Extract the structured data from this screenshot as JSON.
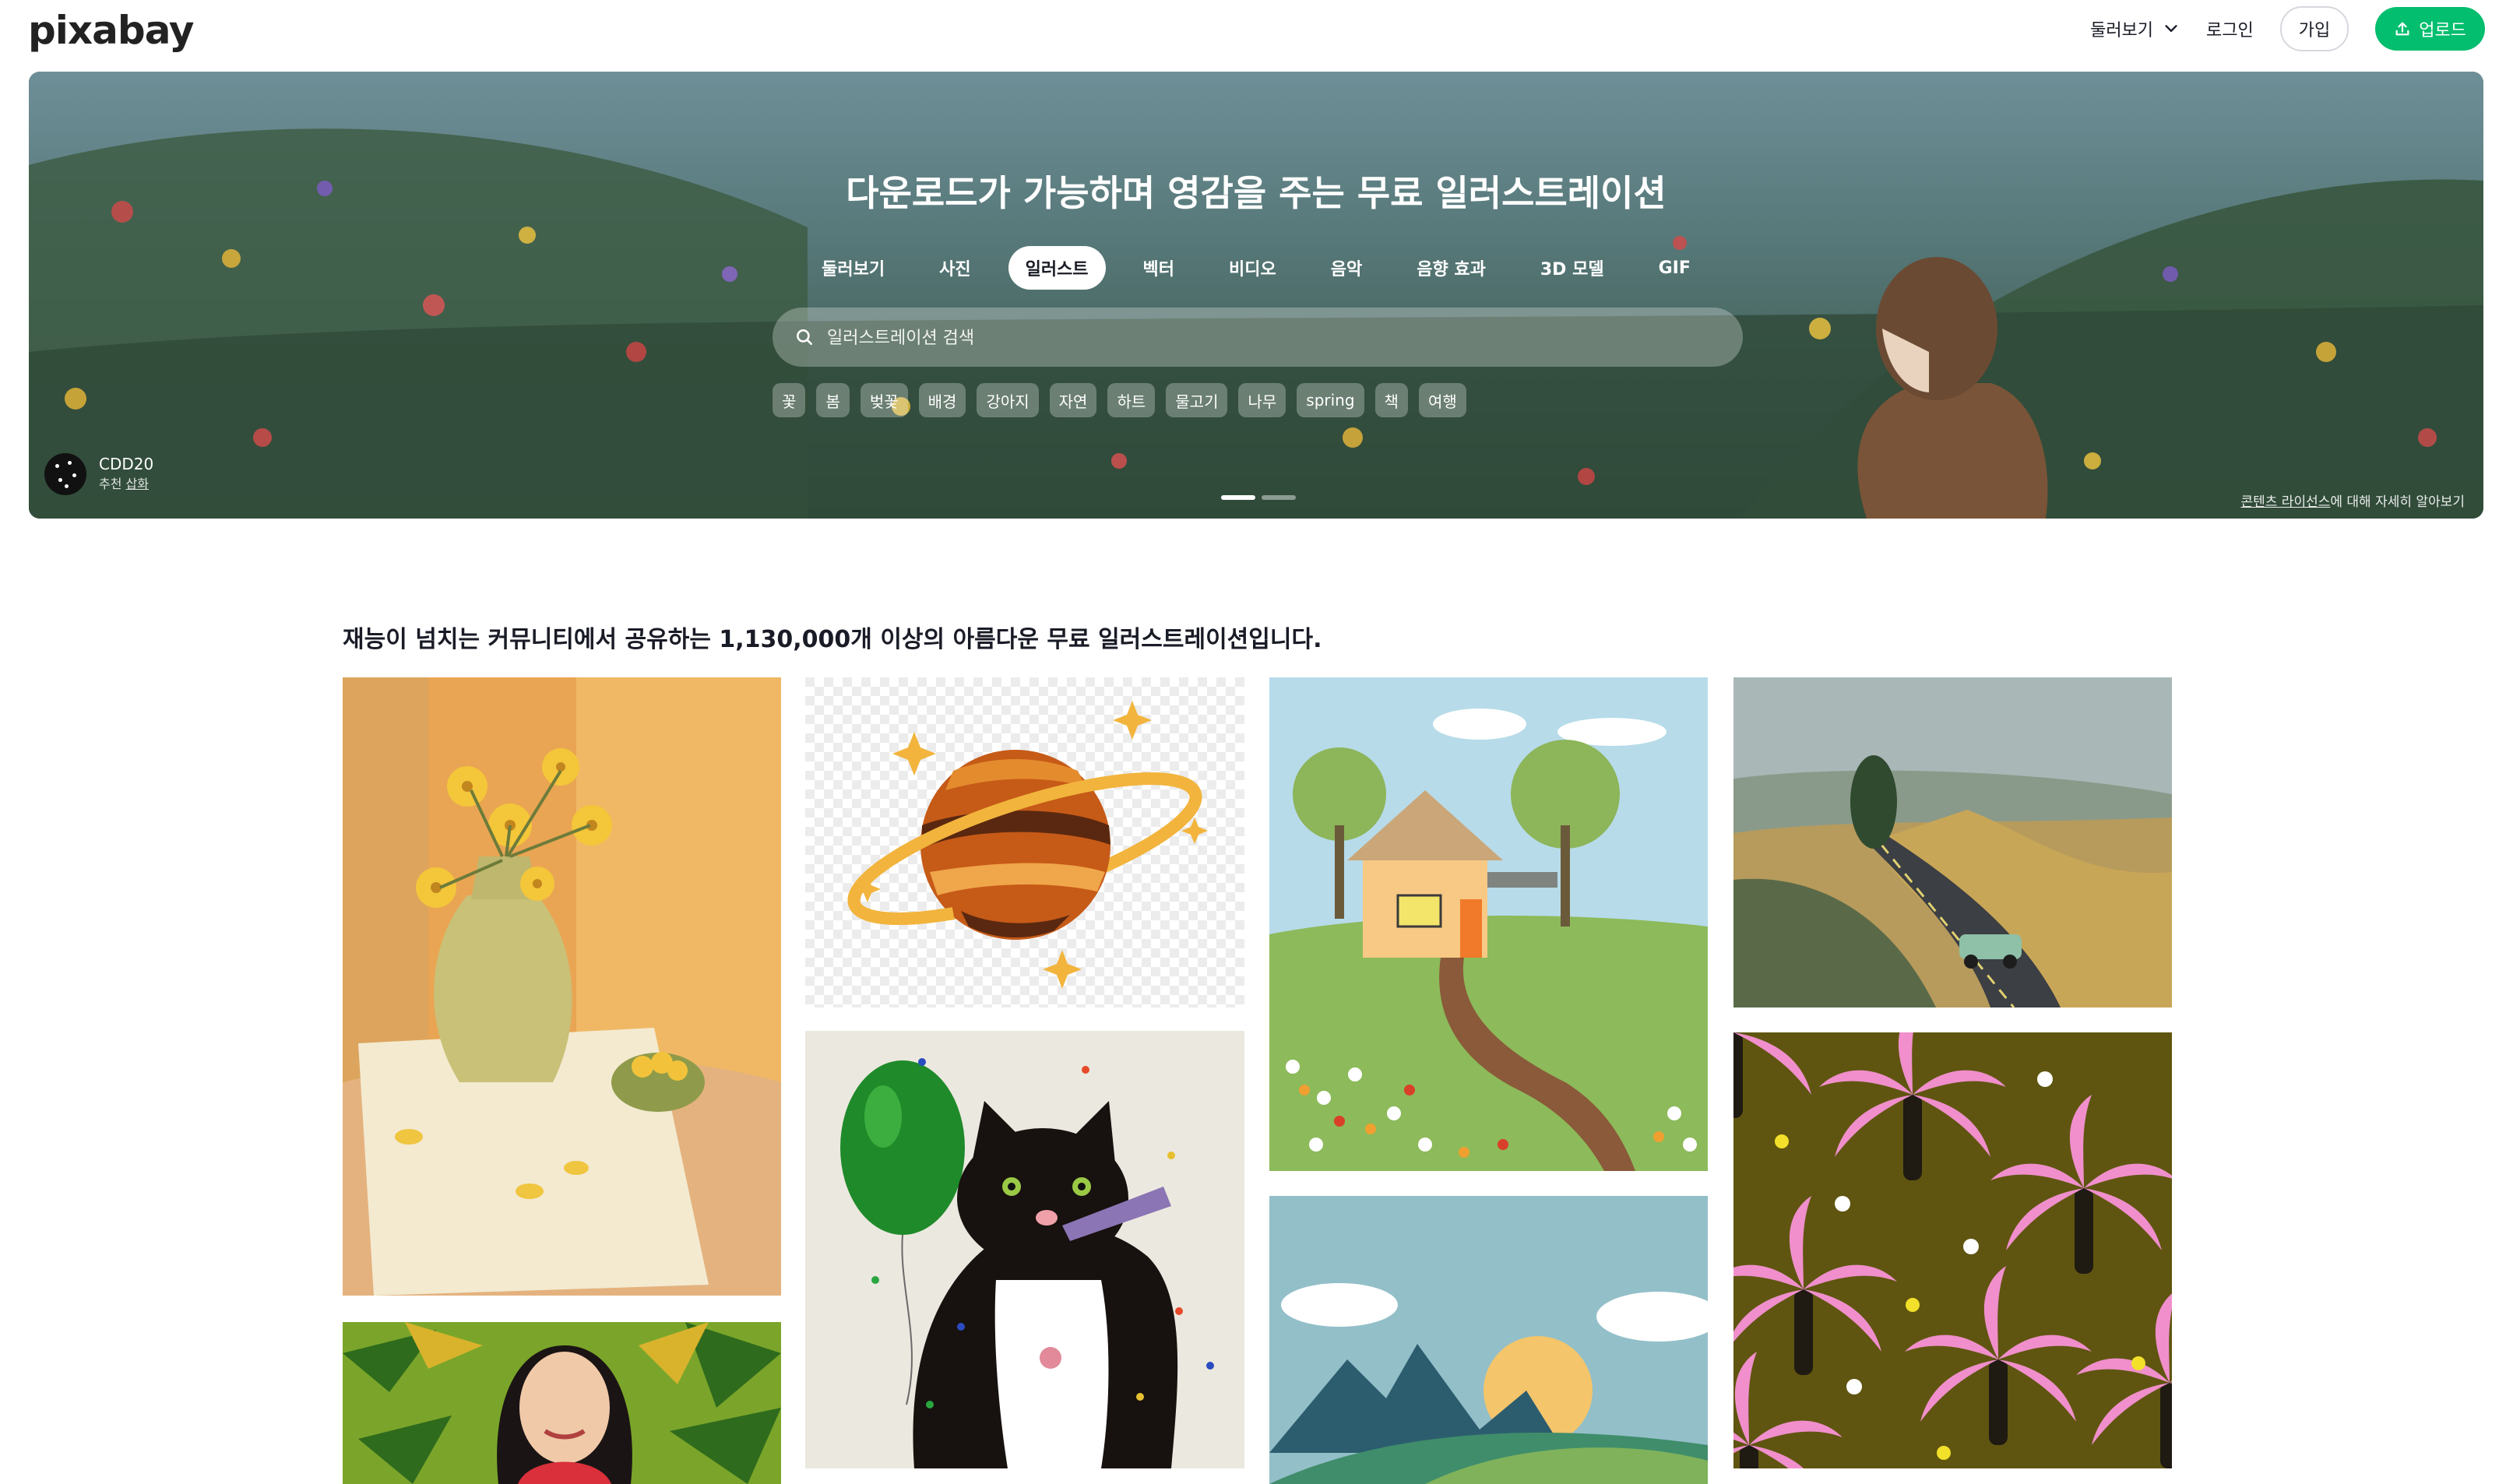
{
  "header": {
    "logo": "pixabay",
    "explore_label": "둘러보기",
    "login_label": "로그인",
    "join_label": "가입",
    "upload_label": "업로드"
  },
  "hero": {
    "title": "다운로드가 가능하며 영감을 주는 무료 일러스트레이션",
    "tabs": [
      "둘러보기",
      "사진",
      "일러스트",
      "벡터",
      "비디오",
      "음악",
      "음향 효과",
      "3D 모델",
      "GIF"
    ],
    "active_tab": "일러스트",
    "search_placeholder": "일러스트레이션 검색",
    "chips": [
      "꽃",
      "봄",
      "벚꽃",
      "배경",
      "강아지",
      "자연",
      "하트",
      "물고기",
      "나무",
      "spring",
      "책",
      "여행"
    ],
    "credit_user": "CDD20",
    "credit_prefix": "추천",
    "credit_link": "삽화",
    "license_link": "콘텐츠 라이선스",
    "license_suffix": "에 대해 자세히 알아보기",
    "slide_count": 2,
    "active_slide": 1
  },
  "main": {
    "headline": "재능이 넘치는 커뮤니티에서 공유하는 1,130,000개 이상의 아름다운 무료 일러스트레이션입니다."
  },
  "gallery": [
    {
      "subject": "yellow flowers in vase"
    },
    {
      "subject": "planet with ring"
    },
    {
      "subject": "countryside house"
    },
    {
      "subject": "road landscape with car"
    },
    {
      "subject": "palm tree pattern"
    },
    {
      "subject": "cat with balloon"
    },
    {
      "subject": "mountains and sunset"
    },
    {
      "subject": "woman portrait with leaves"
    }
  ],
  "colors": {
    "brand_green": "#02be6e",
    "text": "#191b26"
  }
}
